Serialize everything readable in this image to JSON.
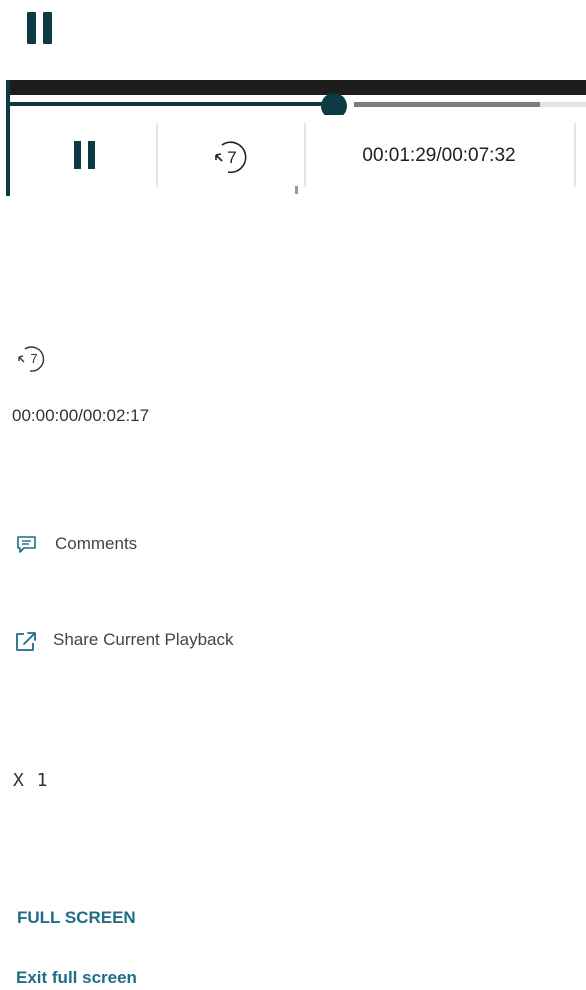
{
  "player": {
    "current_time": "00:01:29/00:07:32",
    "progress_percent": 20,
    "buffered_percent": 92,
    "rewind_seconds": "7",
    "accent_color": "#0b3a45"
  },
  "secondary": {
    "rewind_seconds": "7",
    "time_display": "00:00:00/00:02:17"
  },
  "menu": {
    "comments_label": "Comments",
    "share_label": "Share Current Playback",
    "speed_label": "X 1",
    "fullscreen_label": "FULL SCREEN",
    "exit_fullscreen_label": "Exit full screen",
    "link_color": "#1f6d87"
  }
}
